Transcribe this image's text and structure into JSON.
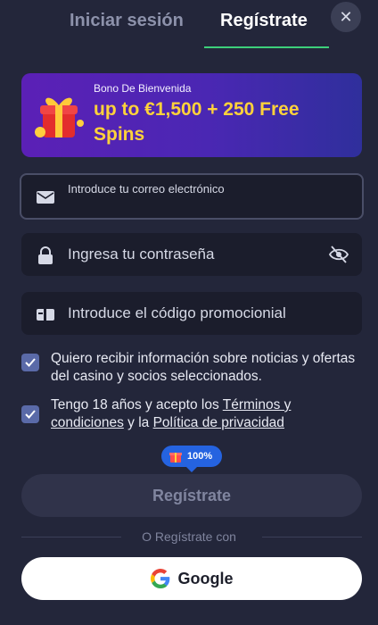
{
  "tabs": {
    "login": "Iniciar sesión",
    "register": "Regístrate"
  },
  "banner": {
    "subtitle": "Bono De Bienvenida",
    "title": "up to €1,500 + 250 Free Spins"
  },
  "fields": {
    "email": "Introduce tu correo electrónico",
    "password": "Ingresa tu contraseña",
    "promo": "Introduce el código promocionial"
  },
  "checkboxes": {
    "news": "Quiero recibir información sobre noticias y ofertas del casino y socios seleccionados.",
    "age_prefix": "Tengo 18 años y acepto los ",
    "terms_link": "Términos y condiciones",
    "age_middle": " y la ",
    "privacy_link": "Política de privacidad"
  },
  "badge": {
    "text": "100%"
  },
  "submit": {
    "label": "Regístrate"
  },
  "divider": {
    "text": "O Regístrate con"
  },
  "google": {
    "label": "Google"
  },
  "colors": {
    "accent": "#3ccf7a",
    "banner_text": "#ffd23a",
    "badge": "#2563e0",
    "background": "#23263a"
  }
}
